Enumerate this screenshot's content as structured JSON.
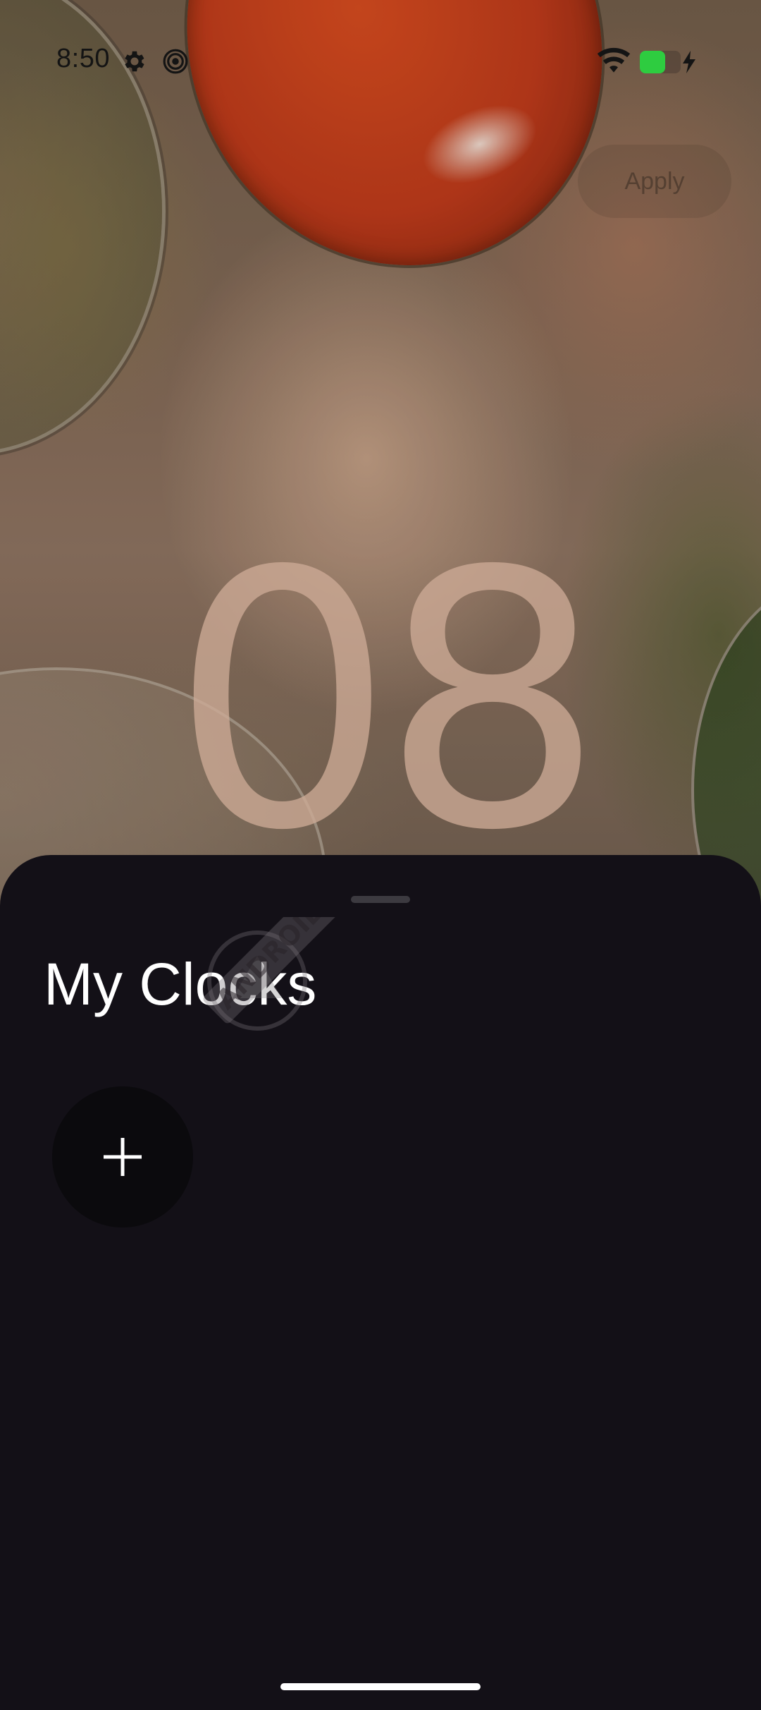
{
  "status_bar": {
    "time": "8:50",
    "icons": [
      "settings-icon",
      "hotspot-icon",
      "wifi-icon",
      "battery-icon",
      "charging-icon"
    ],
    "battery_color": "#2ecc40"
  },
  "header": {
    "apply_label": "Apply"
  },
  "clock_preview": {
    "hour": "08",
    "color": "#cdaa96"
  },
  "sheet": {
    "title": "My Clocks",
    "add_button_icon": "plus-icon",
    "background": "#131017"
  },
  "watermark": {
    "text": "ANDROID AUTHORITY"
  }
}
